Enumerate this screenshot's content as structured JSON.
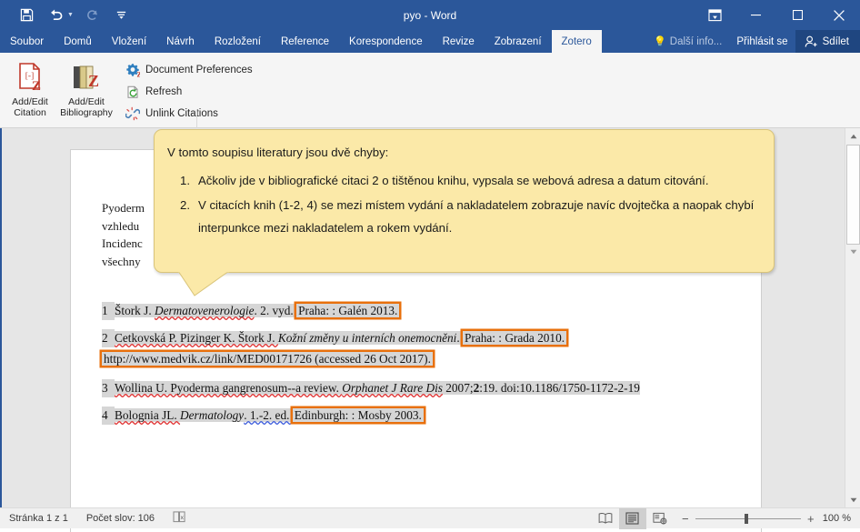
{
  "window": {
    "title": "pyo - Word",
    "quick_access": [
      {
        "name": "save",
        "glyph": "💾",
        "label": "Save"
      },
      {
        "name": "undo",
        "glyph": "↶",
        "label": "Undo"
      },
      {
        "name": "redo",
        "glyph": "↻",
        "label": "Redo"
      },
      {
        "name": "customize-quick-access-toolbar",
        "glyph": "☷",
        "label": "Customize Quick Access Toolbar"
      }
    ],
    "controls": {
      "ribbon_display_options": "Ribbon Display Options",
      "minimize": "—",
      "restore": "☐",
      "close": "✕"
    },
    "accent_color": "#2b579a"
  },
  "ribbon_tabs": [
    {
      "label": "Soubor",
      "active": false
    },
    {
      "label": "Domů",
      "active": false
    },
    {
      "label": "Vložení",
      "active": false
    },
    {
      "label": "Návrh",
      "active": false
    },
    {
      "label": "Rozložení",
      "active": false
    },
    {
      "label": "Reference",
      "active": false
    },
    {
      "label": "Korespondence",
      "active": false
    },
    {
      "label": "Revize",
      "active": false
    },
    {
      "label": "Zobrazení",
      "active": false
    },
    {
      "label": "Zotero",
      "active": true
    }
  ],
  "tabstrip_right": {
    "tell_me": "Další info...",
    "sign_in": "Přihlásit se",
    "share": "Sdílet"
  },
  "ribbon": {
    "group_label": "Zotero",
    "big_buttons": [
      {
        "name": "add-edit-citation",
        "line1": "Add/Edit",
        "line2": "Citation"
      },
      {
        "name": "add-edit-bibliography",
        "line1": "Add/Edit",
        "line2": "Bibliography"
      }
    ],
    "small_buttons": [
      {
        "name": "document-preferences",
        "label": "Document Preferences"
      },
      {
        "name": "refresh",
        "label": "Refresh"
      },
      {
        "name": "unlink-citations",
        "label": "Unlink Citations"
      }
    ],
    "collapse_label": "˄"
  },
  "callout": {
    "intro": "V tomto soupisu literatury jsou dvě chyby:",
    "items": [
      {
        "num": "1.",
        "text": "Ačkoliv jde v bibliografické citaci 2 o tištěnou knihu, vypsala se webová adresa a datum citování."
      },
      {
        "num": "2.",
        "text": "V citacích knih (1-2, 4) se mezi místem vydání a nakladatelem zobrazuje navíc dvojtečka a naopak chybí interpunkce mezi nakladatelem a rokem vydání."
      }
    ],
    "fill_color": "#fbe9a8"
  },
  "document": {
    "paragraph_lines": [
      "Pyoderm",
      "vzhledu",
      "Incidenc",
      "všechny"
    ],
    "bibliography": [
      {
        "num": "1",
        "parts": [
          {
            "t": "Štork J. ",
            "style": "plain"
          },
          {
            "t": "Dermatovenerologie",
            "style": "italic-spell"
          },
          {
            "t": ". 2. vyd. ",
            "style": "plain"
          },
          {
            "t": "Praha: : Galén 2013.",
            "style": "boxed"
          }
        ]
      },
      {
        "num": "2",
        "parts": [
          {
            "t": "Cetkovská P. Pizinger K. Štork J. ",
            "style": "plain"
          },
          {
            "t": "Kožní změny u interních onemocnění",
            "style": "italic"
          },
          {
            "t": ". ",
            "style": "plain"
          },
          {
            "t": "Praha: : Grada 2010.",
            "style": "boxed"
          }
        ],
        "parts2": [
          {
            "t": "http://www.medvik.cz/link/MED00171726 (accessed 26 Oct 2017).",
            "style": "boxed"
          }
        ]
      },
      {
        "num": "3",
        "parts": [
          {
            "t": "Wollina U. Pyoderma gangrenosum--a review. ",
            "style": "plain"
          },
          {
            "t": "Orphanet J Rare Dis",
            "style": "italic"
          },
          {
            "t": " 2007;",
            "style": "plain"
          },
          {
            "t": "2",
            "style": "bold"
          },
          {
            "t": ":19. doi:10.1186/1750-1172-2-19",
            "style": "plain"
          }
        ]
      },
      {
        "num": "4",
        "parts": [
          {
            "t": "Bolognia JL. ",
            "style": "plain"
          },
          {
            "t": "Dermatology",
            "style": "italic"
          },
          {
            "t": ". 1.-2. ed. ",
            "style": "plain"
          },
          {
            "t": "Edinburgh: : Mosby 2003.",
            "style": "boxed"
          }
        ]
      }
    ],
    "highlight_color": "#d6d6d6",
    "box_color": "#e8700c"
  },
  "statusbar": {
    "page": "Stránka 1 z 1",
    "words": "Počet slov: 106",
    "proofing_icon": "proofing-errors-icon",
    "views": [
      {
        "name": "read-mode",
        "active": false
      },
      {
        "name": "print-layout",
        "active": true
      },
      {
        "name": "web-layout",
        "active": false
      }
    ],
    "zoom_out": "−",
    "zoom_in": "+",
    "zoom_value": "100 %"
  }
}
